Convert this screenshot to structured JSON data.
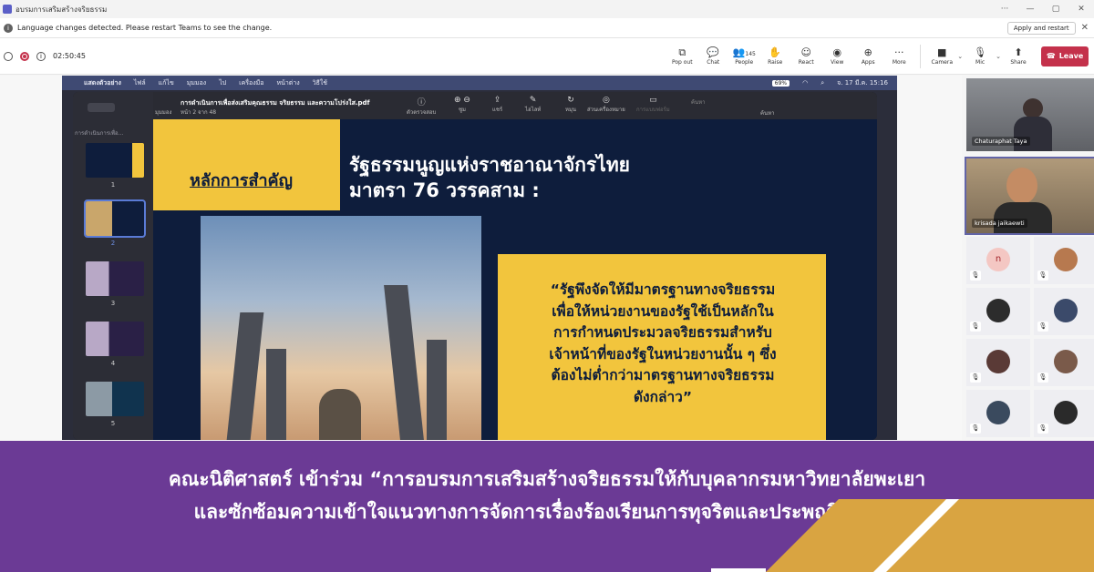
{
  "window": {
    "title": "อบรมการเสริมสร้างจริยธรรม",
    "controls": [
      "···",
      "—",
      "▢",
      "✕"
    ]
  },
  "notice": {
    "message": "Language changes detected. Please restart Teams to see the change.",
    "apply_label": "Apply and restart",
    "close": "✕"
  },
  "toolbar": {
    "timer": "02:50:45",
    "buttons": [
      {
        "label": "Pop out",
        "icon": "⧉"
      },
      {
        "label": "Chat",
        "icon": "💬"
      },
      {
        "label": "People",
        "icon": "👥",
        "count": "145"
      },
      {
        "label": "Raise",
        "icon": "✋"
      },
      {
        "label": "React",
        "icon": "☺"
      },
      {
        "label": "View",
        "icon": "◉"
      },
      {
        "label": "Apps",
        "icon": "⊕"
      },
      {
        "label": "More",
        "icon": "···"
      }
    ],
    "camera_label": "Camera",
    "mic_label": "Mic",
    "share_label": "Share",
    "leave_label": "Leave"
  },
  "mac_menu": {
    "items": [
      "แสดงตัวอย่าง",
      "ไฟล์",
      "แก้ไข",
      "มุมมอง",
      "ไป",
      "เครื่องมือ",
      "หน้าต่าง",
      "วิธีใช้"
    ],
    "battery": "69%",
    "datetime": "จ. 17 มี.ค. 15:16"
  },
  "pdf_viewer": {
    "filename": "การดำเนินการเพื่อส่งเสริมคุณธรรม จริยธรรม และความโปร่งใส.pdf",
    "page_info": "หน้า 2 จาก 48",
    "view_label": "มุมมอง",
    "sidebar_title": "การดำเนินการเพื่อ...",
    "tools": [
      "ตัวตรวจสอบ",
      "ซูม",
      "แชร์",
      "ไฮไลท์",
      "หมุน",
      "ส่วนเครื่องหมาย",
      "การแบบฟอร์ม"
    ],
    "search_placeholder": "ค้นหา",
    "search_label": "ค้นหา",
    "thumbnails": [
      "1",
      "2",
      "3",
      "4",
      "5"
    ]
  },
  "slide": {
    "key_title": "หลักการสำคัญ",
    "const_title_line1": "รัฐธรรมนูญแห่งราชอาณาจักรไทย",
    "const_title_line2": "มาตรา 76 วรรคสาม :",
    "quote_lines": [
      "“รัฐพึงจัดให้มีมาตรฐานทางจริยธรรม",
      "เพื่อให้หน่วยงานของรัฐใช้เป็นหลักใน",
      "การกำหนดประมวลจริยธรรมสำหรับ",
      "เจ้าหน้าที่ของรัฐในหน่วยงานนั้น ๆ ซึ่ง",
      "ต้องไม่ต่ำกว่ามาตรฐานทางจริยธรรม",
      "ดังกล่าว”"
    ]
  },
  "participants": {
    "video1_name": "Chaturaphat Taya",
    "video2_name": "krisada jaikaewti",
    "tile_initial": "n"
  },
  "banner": {
    "line1": "คณะนิติศาสตร์ เข้าร่วม “การอบรมการเสริมสร้างจริยธรรมให้กับบุคลากรมหาวิทยาลัยพะเยา",
    "line2": "และซักซ้อมความเข้าใจแนวทางการจัดการเรื่องร้องเรียนการทุจริตและประพฤติมิชอบ”"
  },
  "colors": {
    "teams_purple": "#5b5fc7",
    "leave_red": "#c4314b",
    "slide_navy": "#0e1d3c",
    "slide_gold": "#f2c53d",
    "banner_purple": "#6b3a95",
    "deco_gold": "#d9a441"
  }
}
